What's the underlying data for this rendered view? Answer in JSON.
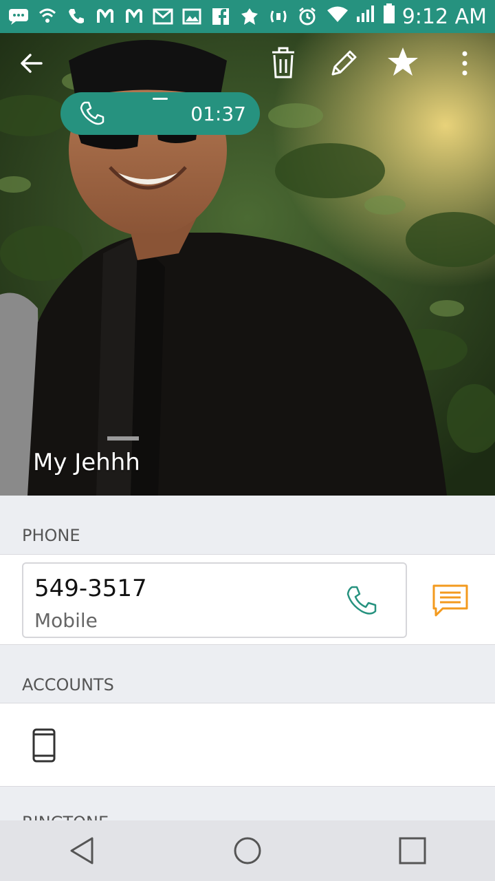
{
  "status_bar": {
    "time": "9:12 AM",
    "notification_icons": [
      "chat-icon",
      "wifi-call-icon",
      "phone-icon",
      "malwarebytes-icon",
      "malwarebytes-icon",
      "gmail-icon",
      "gallery-icon",
      "facebook-icon",
      "game-icon",
      "speaker-icon",
      "alarm-icon",
      "wifi-icon",
      "signal-icon",
      "battery-icon"
    ]
  },
  "toolbar": {
    "back_icon": "arrow-left-icon",
    "delete_icon": "trash-icon",
    "edit_icon": "pencil-icon",
    "favorite_icon": "star-icon",
    "more_icon": "more-vertical-icon"
  },
  "call_pill": {
    "timer": "01:37",
    "icon": "phone-icon"
  },
  "contact": {
    "name": "My Jehhh"
  },
  "phone_section": {
    "header": "PHONE",
    "number": "549-3517",
    "type": "Mobile",
    "call_icon": "phone-icon",
    "message_icon": "message-icon"
  },
  "accounts_section": {
    "header": "ACCOUNTS",
    "device_icon": "smartphone-icon"
  },
  "ringtone_section": {
    "header": "RINGTONE"
  },
  "nav": {
    "back_icon": "nav-back-icon",
    "home_icon": "nav-home-icon",
    "recents_icon": "nav-recents-icon"
  },
  "colors": {
    "accent": "#26927f",
    "message_orange": "#f39a1e"
  }
}
